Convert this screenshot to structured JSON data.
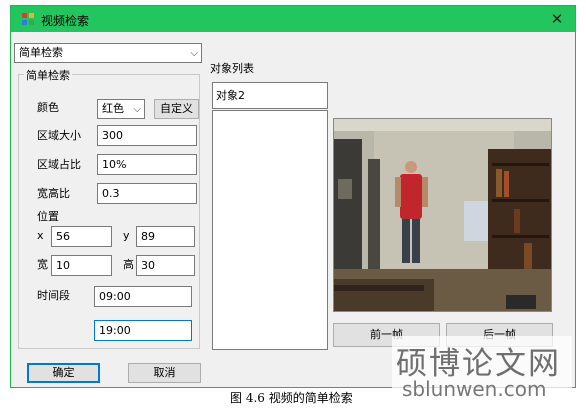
{
  "window": {
    "title": "视频检索",
    "close_glyph": "✕",
    "icon": "app-palette-icon",
    "accent_color": "#22c55e"
  },
  "search_mode": {
    "selected": "简单检索"
  },
  "simple_search": {
    "group_title": "简单检索",
    "color_label": "颜色",
    "color_selected": "红色",
    "custom_button": "自定义",
    "area_size_label": "区域大小",
    "area_size_value": "300",
    "area_ratio_label": "区域占比",
    "area_ratio_value": "10%",
    "aspect_label": "宽高比",
    "aspect_value": "0.3",
    "position_label": "位置",
    "x_label": "x",
    "x_value": "56",
    "y_label": "y",
    "y_value": "89",
    "width_label": "宽",
    "width_value": "10",
    "height_label": "高",
    "height_value": "30",
    "time_label": "时间段",
    "time_start": "09:00",
    "time_end": "19:00"
  },
  "objects": {
    "title": "对象列表",
    "items": [
      "对象2"
    ]
  },
  "player": {
    "prev_label": "前一帧",
    "next_label": "后一帧"
  },
  "footer": {
    "ok_label": "确定",
    "cancel_label": "取消"
  },
  "caption": "图 4.6 视频的简单检索",
  "watermark": {
    "main": "硕博论文网",
    "url": "sblunwen.com"
  }
}
